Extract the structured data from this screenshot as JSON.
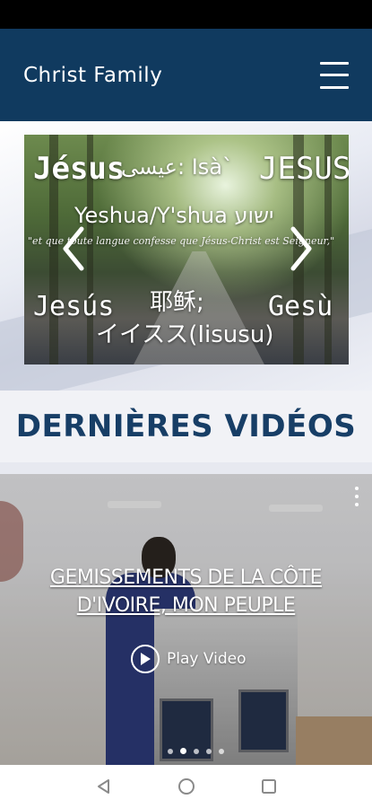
{
  "header": {
    "title": "Christ Family",
    "menu_icon": "hamburger-menu-icon"
  },
  "slider": {
    "slide_texts": {
      "jesus_fr": "Jésus",
      "arabic": "عيسى: Isà`",
      "jesus_en": "JESUS",
      "yeshua": "Yeshua/Y'shua ישוע",
      "quote": "\"et que toute langue confesse que Jésus-Christ est Seigneur,\"",
      "jesus_es": "Jesús",
      "chinese": "耶稣;",
      "gesu": "Gesù",
      "japanese": "イイスス(Iisusu)"
    },
    "prev_icon": "chevron-left-icon",
    "next_icon": "chevron-right-icon"
  },
  "section": {
    "title": "DERNIÈRES VIDÉOS"
  },
  "video": {
    "title": "GEMISSEMENTS DE LA CÔTE D'IVOIRE, MON PEUPLE",
    "play_label": "Play Video",
    "play_icon": "play-icon",
    "more_icon": "more-vertical-icon",
    "pagination": {
      "count": 5,
      "active_index": 1
    }
  },
  "system_nav": {
    "back_icon": "back-triangle-icon",
    "home_icon": "home-circle-icon",
    "recents_icon": "recents-square-icon"
  },
  "colors": {
    "header_bg": "#103a5f",
    "section_title": "#173e66",
    "status_bar": "#000000"
  }
}
